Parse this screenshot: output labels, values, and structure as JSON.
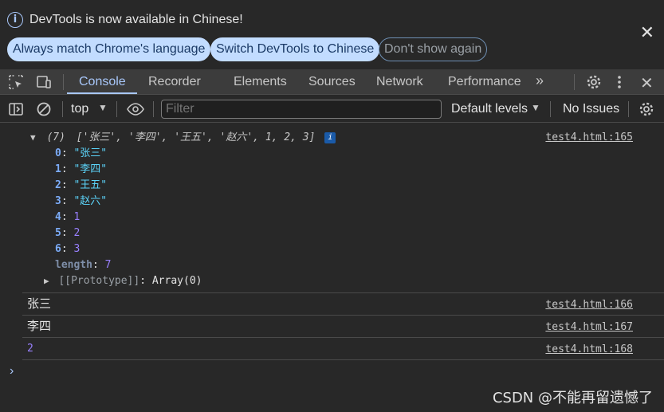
{
  "infobar": {
    "message": "DevTools is now available in Chinese!",
    "btn_match": "Always match Chrome's language",
    "btn_switch": "Switch DevTools to Chinese",
    "btn_dont_show": "Don't show again",
    "close_icon": "close-icon",
    "info_icon": "info-icon"
  },
  "tabs": {
    "console": "Console",
    "recorder": "Recorder",
    "elements": "Elements",
    "sources": "Sources",
    "network": "Network",
    "performance": "Performance",
    "more": "»"
  },
  "toolbar": {
    "context": "top",
    "filter_placeholder": "Filter",
    "levels": "Default levels",
    "issues": "No Issues"
  },
  "console": {
    "array_summary": {
      "length_tag": "(7)",
      "preview": "['张三', '李四', '王五', '赵六', 1, 2, 3]"
    },
    "entries": [
      {
        "key": "0",
        "value": "\"张三\"",
        "type": "str"
      },
      {
        "key": "1",
        "value": "\"李四\"",
        "type": "str"
      },
      {
        "key": "2",
        "value": "\"王五\"",
        "type": "str"
      },
      {
        "key": "3",
        "value": "\"赵六\"",
        "type": "str"
      },
      {
        "key": "4",
        "value": "1",
        "type": "num"
      },
      {
        "key": "5",
        "value": "2",
        "type": "num"
      },
      {
        "key": "6",
        "value": "3",
        "type": "num"
      }
    ],
    "length_key": "length",
    "length_value": "7",
    "prototype_key": "[[Prototype]]",
    "prototype_value": "Array(0)",
    "logs": [
      {
        "text": "张三",
        "source": "test4.html:166"
      },
      {
        "text": "李四",
        "source": "test4.html:167"
      },
      {
        "text": "2",
        "source": "test4.html:168"
      }
    ],
    "first_source": "test4.html:165",
    "prompt": "›"
  },
  "watermark": "CSDN @不能再留遗憾了",
  "colors": {
    "accent": "#a8c7fa",
    "string": "#5cd5fb",
    "number": "#9980ff",
    "key": "#7cacf8"
  }
}
